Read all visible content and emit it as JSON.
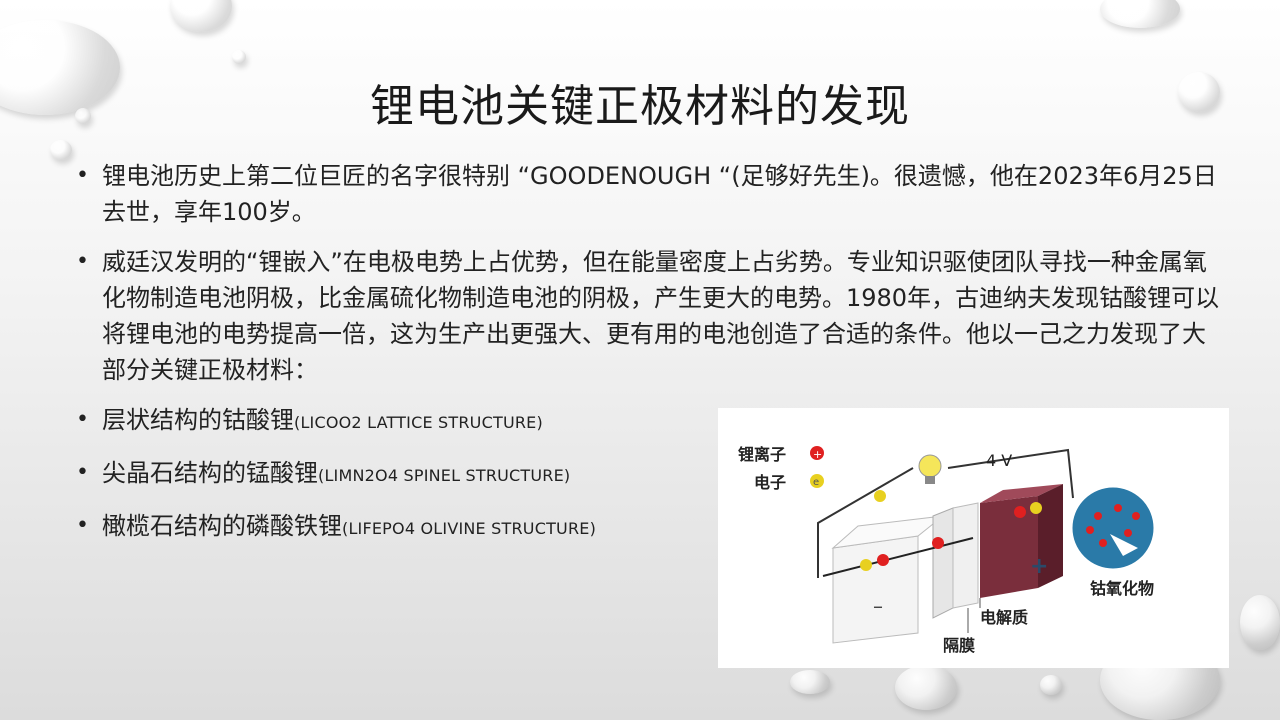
{
  "slide": {
    "title": "锂电池关键正极材料的发现",
    "bullets": [
      {
        "text": "锂电池历史上第二位巨匠的名字很特别 “GOODENOUGH “(足够好先生)。很遗憾，他在2023年6月25日去世，享年100岁。"
      },
      {
        "text": "威廷汉发明的“锂嵌入”在电极电势上占优势，但在能量密度上占劣势。专业知识驱使团队寻找一种金属氧化物制造电池阴极，比金属硫化物制造电池的阴极，产生更大的电势。1980年，古迪纳夫发现钴酸锂可以将锂电池的电势提高一倍，这为生产出更强大、更有用的电池创造了合适的条件。他以一己之力发现了大部分关键正极材料："
      },
      {
        "main": "层状结构的钴酸锂",
        "note": "(LICOO2 LATTICE STRUCTURE)"
      },
      {
        "main": "尖晶石结构的锰酸锂",
        "note": "(LIMN2O4 SPINEL STRUCTURE)"
      },
      {
        "main": "橄榄石结构的磷酸铁锂",
        "note": "(LIFEPO4 OLIVINE STRUCTURE)"
      }
    ]
  },
  "figure": {
    "legend_ion": "锂离子",
    "legend_electron": "电子",
    "voltage": "4 V",
    "label_cobalt_oxide": "钴氧化物",
    "label_electrolyte": "电解质",
    "label_separator": "隔膜",
    "minus_sign": "–",
    "plus_sign": "+",
    "ion_symbol": "+",
    "electron_symbol": "e",
    "colors": {
      "ion": "#e02020",
      "electron": "#e8d020",
      "cathode": "#8a3040",
      "crystal": "#2a7aa8"
    }
  }
}
